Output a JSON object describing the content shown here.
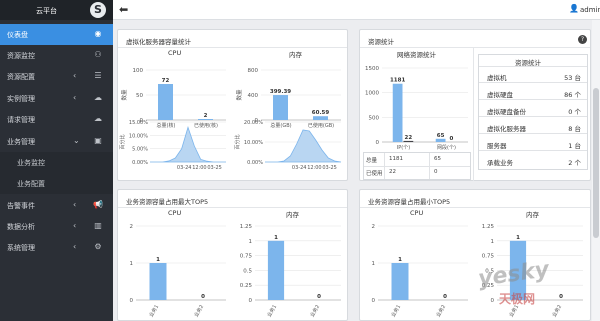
{
  "app": {
    "title": "云平台",
    "logo_glyph": "S"
  },
  "topbar": {
    "back_glyph": "⬅",
    "user_glyph": "👤",
    "user": "admin"
  },
  "sidebar": {
    "items": [
      {
        "label": "仪表盘",
        "icon": "dashboard-icon",
        "glyph": "◉",
        "active": true
      },
      {
        "label": "资源监控",
        "icon": "binoculars-icon",
        "glyph": "⚇"
      },
      {
        "label": "资源配置",
        "icon": "list-icon",
        "glyph": "☰",
        "chevron": "‹"
      },
      {
        "label": "实例管理",
        "icon": "cloud-icon",
        "glyph": "☁",
        "chevron": "‹"
      },
      {
        "label": "请求管理",
        "icon": "cloud-upload-icon",
        "glyph": "☁"
      },
      {
        "label": "业务管理",
        "icon": "book-icon",
        "glyph": "▣",
        "chevron": "⌄"
      },
      {
        "label": "告警事件",
        "icon": "megaphone-icon",
        "glyph": "📢",
        "chevron": "‹"
      },
      {
        "label": "数据分析",
        "icon": "chart-icon",
        "glyph": "▥",
        "chevron": "‹"
      },
      {
        "label": "系统管理",
        "icon": "gear-icon",
        "glyph": "⚙",
        "chevron": "‹"
      }
    ],
    "sub_items": [
      {
        "label": "业务监控"
      },
      {
        "label": "业务配置"
      }
    ]
  },
  "panels": {
    "virt": {
      "title": "虚拟化服务器容量统计",
      "cpu_label": "CPU",
      "mem_label": "内存"
    },
    "resource": {
      "title": "资源统计",
      "help_glyph": "?",
      "left_title": "网络资源统计",
      "right_title": "资源统计"
    },
    "top5_max": {
      "title": "业务资源容量占用最大TOP5",
      "cpu_label": "CPU",
      "mem_label": "内存"
    },
    "top5_min": {
      "title": "业务资源容量占用最小TOP5",
      "cpu_label": "CPU",
      "mem_label": "内存"
    }
  },
  "resource_stats": [
    {
      "k": "虚拟机",
      "v": "53 台"
    },
    {
      "k": "虚拟硬盘",
      "v": "86 个"
    },
    {
      "k": "虚拟硬盘备份",
      "v": "0 个"
    },
    {
      "k": "虚拟化服务器",
      "v": "8 台"
    },
    {
      "k": "服务器",
      "v": "1 台"
    },
    {
      "k": "承载业务",
      "v": "2 个"
    }
  ],
  "net_table": {
    "rows": [
      {
        "label": "总量",
        "a": "1181",
        "b": "65"
      },
      {
        "label": "已使用",
        "a": "22",
        "b": "0"
      }
    ]
  },
  "chart_data": [
    {
      "type": "bar",
      "title": "CPU",
      "ylabel": "数量",
      "categories": [
        "总量(核)",
        "已使用(核)"
      ],
      "values": [
        72,
        2
      ],
      "ylim": [
        0,
        100
      ],
      "yticks": [
        "0",
        "50",
        "100"
      ],
      "colors": [
        "#7cb5ec",
        "#7cb5ec"
      ],
      "value_labels": [
        "72",
        "2"
      ]
    },
    {
      "type": "bar",
      "title": "内存",
      "ylabel": "数量",
      "categories": [
        "总量(GB)",
        "已使用(GB)"
      ],
      "values": [
        399.39,
        60.59
      ],
      "ylim": [
        0,
        800
      ],
      "yticks": [
        "0",
        "400",
        "800"
      ],
      "colors": [
        "#7cb5ec",
        "#7cb5ec"
      ],
      "value_labels": [
        "399.39",
        "60.59"
      ]
    },
    {
      "type": "area",
      "ylabel": "百分比",
      "yticks": [
        "0.00%",
        "5.00%",
        "10.00%",
        "15.00%"
      ],
      "ylim": [
        0,
        15
      ],
      "xticks": [
        "03-24",
        "12:00",
        "03-25"
      ],
      "values": [
        0,
        0,
        0,
        0.4,
        1.5,
        5,
        13,
        6,
        1,
        0.3,
        0,
        0,
        0
      ]
    },
    {
      "type": "area",
      "ylabel": "百分比",
      "yticks": [
        "0.00%",
        "10.00%",
        "20.00%"
      ],
      "ylim": [
        0,
        20
      ],
      "xticks": [
        "03-24",
        "12:00",
        "03-25"
      ],
      "values": [
        0,
        0,
        0,
        0.5,
        3,
        9,
        16,
        15.5,
        11,
        6,
        2,
        0.5,
        0
      ]
    },
    {
      "type": "bar",
      "title": "网络资源统计",
      "categories": [
        "IP(个)",
        "网段(个)"
      ],
      "series": [
        {
          "values": [
            1181,
            65
          ],
          "color": "#7cb5ec",
          "value_labels": [
            "1181",
            "65"
          ]
        },
        {
          "values": [
            22,
            0
          ],
          "color": "#434348",
          "value_labels": [
            "22",
            "0"
          ]
        }
      ],
      "ylim": [
        0,
        1500
      ],
      "yticks": [
        "0",
        "500",
        "1000",
        "1500"
      ]
    },
    {
      "type": "bar",
      "title": "CPU",
      "categories": [
        "业务1",
        "业务2"
      ],
      "values": [
        1,
        0
      ],
      "ylim": [
        0,
        2
      ],
      "yticks": [
        "0",
        "1",
        "2"
      ],
      "value_labels": [
        "1",
        "0"
      ]
    },
    {
      "type": "bar",
      "title": "内存",
      "categories": [
        "业务1",
        "业务2"
      ],
      "values": [
        1,
        0
      ],
      "ylim": [
        0,
        1.25
      ],
      "yticks": [
        "0",
        "0.25",
        "0.5",
        "0.75",
        "1",
        "1.25"
      ],
      "value_labels": [
        "1",
        "0"
      ]
    },
    {
      "type": "bar",
      "title": "CPU",
      "categories": [
        "业务1",
        "业务2"
      ],
      "values": [
        1,
        0
      ],
      "ylim": [
        0,
        2
      ],
      "yticks": [
        "0",
        "1",
        "2"
      ],
      "value_labels": [
        "1",
        "0"
      ]
    },
    {
      "type": "bar",
      "title": "内存",
      "categories": [
        "业务1",
        "业务2"
      ],
      "values": [
        1,
        0
      ],
      "ylim": [
        0,
        1.25
      ],
      "yticks": [
        "0",
        "0.25",
        "0.5",
        "0.75",
        "1",
        "1.25"
      ],
      "value_labels": [
        "1",
        "0"
      ]
    }
  ],
  "watermark": {
    "text": "yesky",
    "sub": "天极网"
  }
}
